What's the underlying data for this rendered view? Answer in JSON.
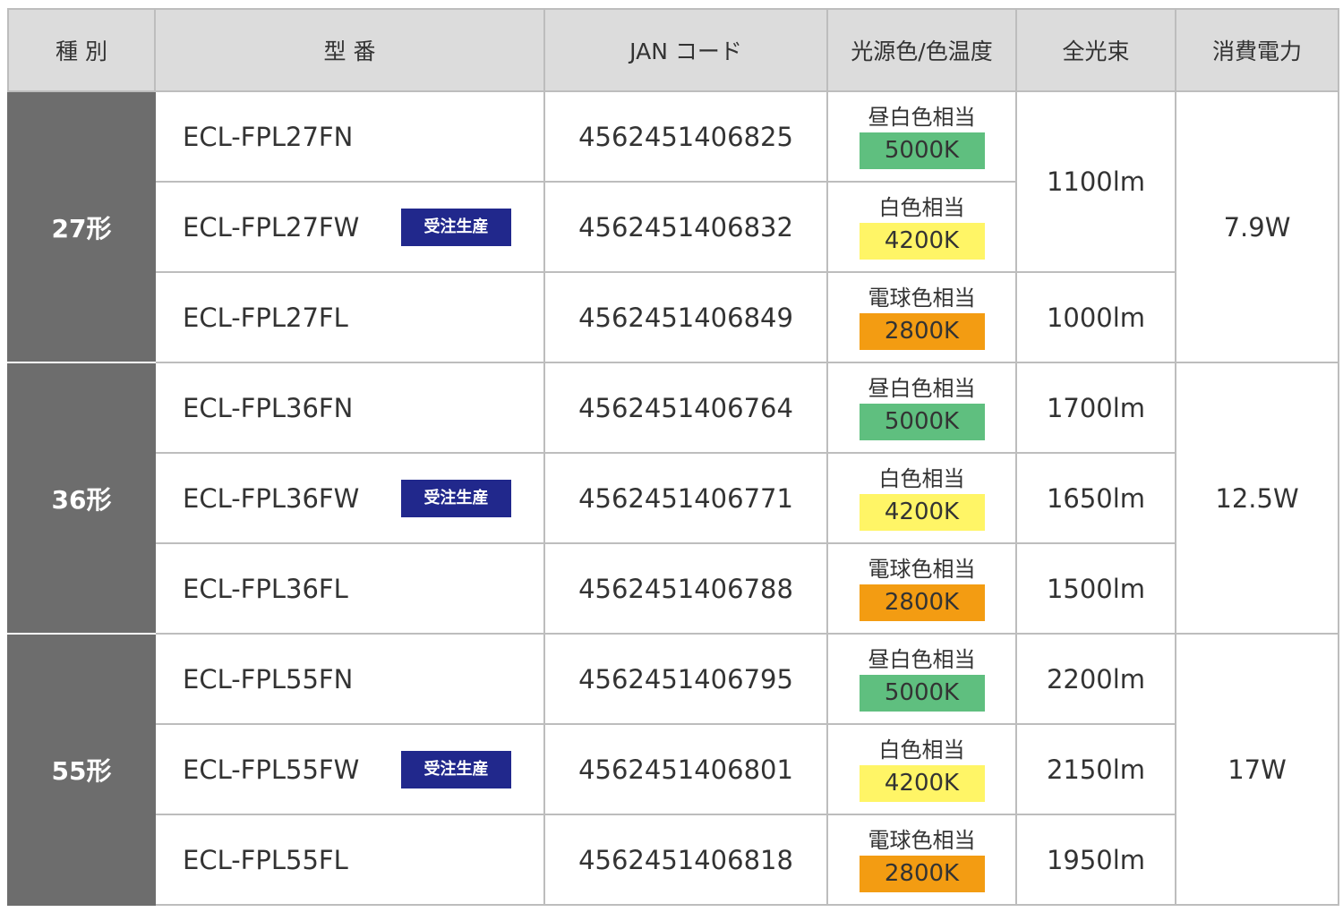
{
  "headers": {
    "type": "種 別",
    "model": "型 番",
    "jan": "JAN コード",
    "color": "光源色/色温度",
    "lumen": "全光束",
    "power": "消費電力"
  },
  "colors": {
    "header_bg": "#dcdcdc",
    "type_bg": "#6d6d6d",
    "badge_bg": "#21288c",
    "temp_5000": "#5fbf7f",
    "temp_4200": "#fff566",
    "temp_2800": "#f39c12"
  },
  "groups": [
    {
      "type": "27形",
      "power": "7.9W",
      "rows": [
        {
          "model": "ECL-FPL27FN",
          "badge": "",
          "jan": "4562451406825",
          "color_name": "昼白色相当",
          "temp": "5000K",
          "temp_color": "#5fbf7f"
        },
        {
          "model": "ECL-FPL27FW",
          "badge": "受注生産",
          "jan": "4562451406832",
          "color_name": "白色相当",
          "temp": "4200K",
          "temp_color": "#fff566"
        },
        {
          "model": "ECL-FPL27FL",
          "badge": "",
          "jan": "4562451406849",
          "color_name": "電球色相当",
          "temp": "2800K",
          "temp_color": "#f39c12"
        }
      ],
      "lumens": [
        {
          "value": "1100lm",
          "rowspan": 2
        },
        {
          "value": "1000lm",
          "rowspan": 1
        }
      ]
    },
    {
      "type": "36形",
      "power": "12.5W",
      "rows": [
        {
          "model": "ECL-FPL36FN",
          "badge": "",
          "jan": "4562451406764",
          "color_name": "昼白色相当",
          "temp": "5000K",
          "temp_color": "#5fbf7f"
        },
        {
          "model": "ECL-FPL36FW",
          "badge": "受注生産",
          "jan": "4562451406771",
          "color_name": "白色相当",
          "temp": "4200K",
          "temp_color": "#fff566"
        },
        {
          "model": "ECL-FPL36FL",
          "badge": "",
          "jan": "4562451406788",
          "color_name": "電球色相当",
          "temp": "2800K",
          "temp_color": "#f39c12"
        }
      ],
      "lumens": [
        {
          "value": "1700lm",
          "rowspan": 1
        },
        {
          "value": "1650lm",
          "rowspan": 1
        },
        {
          "value": "1500lm",
          "rowspan": 1
        }
      ]
    },
    {
      "type": "55形",
      "power": "17W",
      "rows": [
        {
          "model": "ECL-FPL55FN",
          "badge": "",
          "jan": "4562451406795",
          "color_name": "昼白色相当",
          "temp": "5000K",
          "temp_color": "#5fbf7f"
        },
        {
          "model": "ECL-FPL55FW",
          "badge": "受注生産",
          "jan": "4562451406801",
          "color_name": "白色相当",
          "temp": "4200K",
          "temp_color": "#fff566"
        },
        {
          "model": "ECL-FPL55FL",
          "badge": "",
          "jan": "4562451406818",
          "color_name": "電球色相当",
          "temp": "2800K",
          "temp_color": "#f39c12"
        }
      ],
      "lumens": [
        {
          "value": "2200lm",
          "rowspan": 1
        },
        {
          "value": "2150lm",
          "rowspan": 1
        },
        {
          "value": "1950lm",
          "rowspan": 1
        }
      ]
    }
  ]
}
